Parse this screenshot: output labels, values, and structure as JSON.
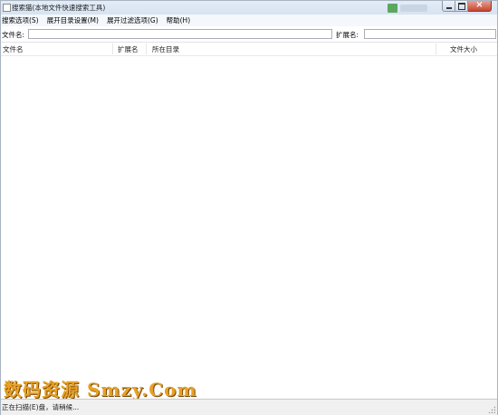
{
  "window": {
    "title": "搜索猫(本地文件快速搜索工具)"
  },
  "menu": {
    "items": [
      {
        "label": "搜索选项(S)"
      },
      {
        "label": "展开目录设置(M)"
      },
      {
        "label": "展开过滤选项(G)"
      },
      {
        "label": "帮助(H)"
      }
    ]
  },
  "search": {
    "filename_label": "文件名:",
    "filename_value": "",
    "ext_label": "扩展名:",
    "ext_value": ""
  },
  "list": {
    "columns": [
      {
        "label": "文件名"
      },
      {
        "label": "扩展名"
      },
      {
        "label": "所在目录"
      },
      {
        "label": "文件大小"
      }
    ],
    "rows": []
  },
  "watermark": {
    "text": "数码资源 Smzy.Com"
  },
  "status": {
    "text": "正在扫描(E)盘，请稍候..."
  },
  "colors": {
    "titlebar": "#dce7f4",
    "close_button": "#c5452f",
    "watermark": "#e8a126"
  },
  "icons": {
    "app": "app-icon",
    "minimize": "minimize-icon",
    "maximize": "maximize-icon",
    "close": "close-icon",
    "resize_grip": "resize-grip-icon"
  }
}
